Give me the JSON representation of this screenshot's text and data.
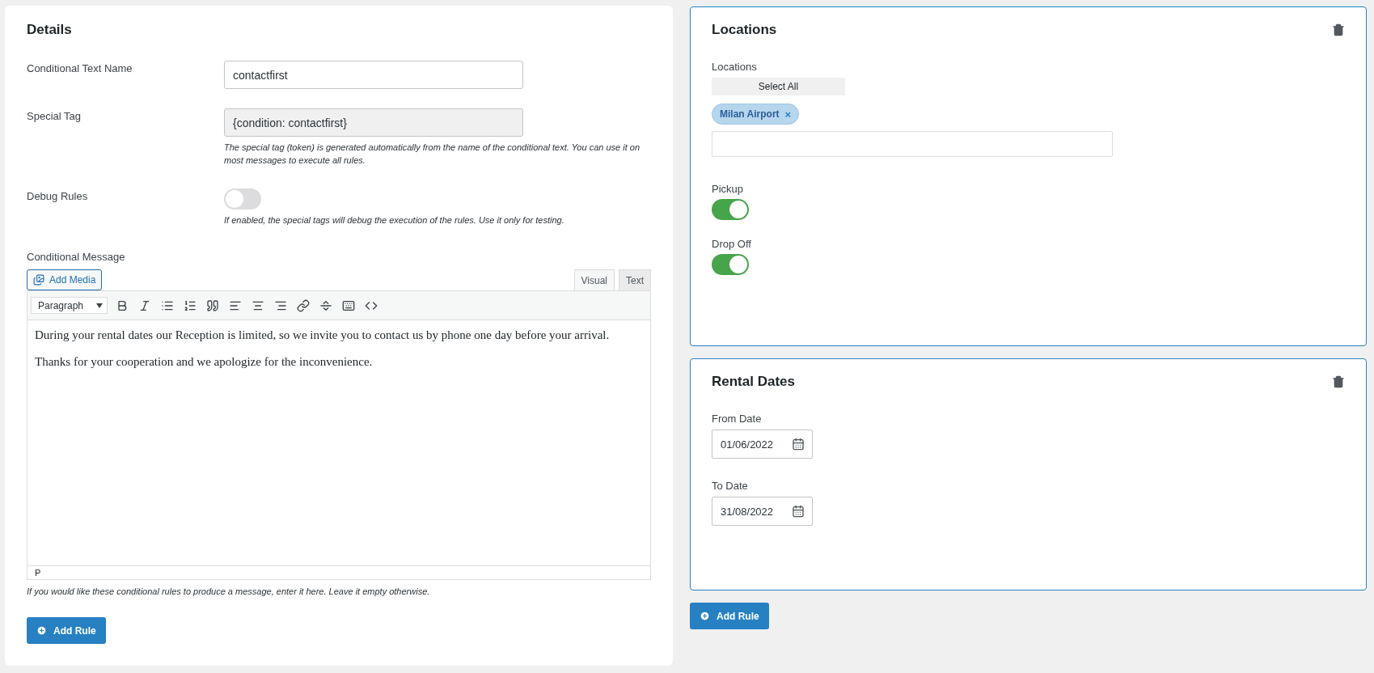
{
  "details": {
    "title": "Details",
    "name_field": {
      "label": "Conditional Text Name",
      "value": "contactfirst"
    },
    "special_tag": {
      "label": "Special Tag",
      "value": "{condition: contactfirst}",
      "hint": "The special tag (token) is generated automatically from the name of the conditional text. You can use it on most messages to execute all rules."
    },
    "debug": {
      "label": "Debug Rules",
      "on": false,
      "hint": "If enabled, the special tags will debug the execution of the rules. Use it only for testing."
    },
    "message": {
      "label": "Conditional Message",
      "add_media": "Add Media",
      "tabs": [
        {
          "label": "Visual",
          "selected": true
        },
        {
          "label": "Text",
          "selected": false
        }
      ],
      "format": "Paragraph",
      "paragraphs": [
        "During your rental dates our Reception is limited, so we invite you to contact us by phone one day before your arrival.",
        "Thanks for your cooperation and we apologize for the inconvenience."
      ],
      "path": "P",
      "hint": "If you would like these conditional rules to produce a message, enter it here. Leave it empty otherwise."
    },
    "add_rule": "Add Rule"
  },
  "rules": [
    {
      "kind": "locations",
      "title": "Locations",
      "field_label": "Locations",
      "select_all": "Select All",
      "chips": [
        "Milan Airport"
      ],
      "remove_mark": "×",
      "toggles": [
        {
          "label": "Pickup",
          "on": true
        },
        {
          "label": "Drop Off",
          "on": true
        }
      ]
    },
    {
      "kind": "dates",
      "title": "Rental Dates",
      "dates": [
        {
          "label": "From Date",
          "value": "01/06/2022"
        },
        {
          "label": "To Date",
          "value": "31/08/2022"
        }
      ]
    }
  ],
  "add_rule": "Add Rule"
}
